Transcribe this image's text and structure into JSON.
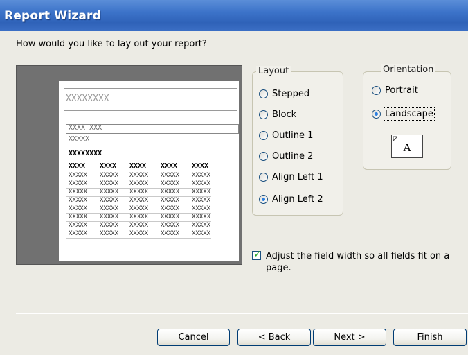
{
  "window": {
    "title": "Report Wizard"
  },
  "question": "How would you like to lay out your report?",
  "preview": {
    "header": "XXXXXXXX",
    "group1": "XXXX XXX",
    "group2": "XXXXX",
    "section": "XXXXXXXX",
    "col_headers": [
      "XXXX",
      "XXXX",
      "XXXX",
      "XXXX",
      "XXXX"
    ],
    "row_cell": "XXXXX",
    "row_count": 8
  },
  "layout": {
    "legend": "Layout",
    "options": [
      {
        "label": "Stepped",
        "accel": "S",
        "selected": false
      },
      {
        "label": "Block",
        "accel": "k",
        "selected": false
      },
      {
        "label": "Outline 1",
        "accel": "O",
        "selected": false
      },
      {
        "label": "Outline 2",
        "accel": "u",
        "selected": false
      },
      {
        "label": "Align Left 1",
        "accel": "A",
        "selected": false
      },
      {
        "label": "Align Left 2",
        "accel": "i",
        "selected": true
      }
    ]
  },
  "orientation": {
    "legend": "Orientation",
    "options": [
      {
        "label": "Portrait",
        "selected": false
      },
      {
        "label": "Landscape",
        "selected": true
      }
    ],
    "icon_letter": "A"
  },
  "adjust_width": {
    "label": "Adjust the field width so all fields fit on a page.",
    "checked": true
  },
  "buttons": {
    "cancel": "Cancel",
    "back": "< Back",
    "next": "Next >",
    "finish": "Finish"
  },
  "colors": {
    "title_bar": "#3c73c9",
    "dialog_bg": "#ecebe4",
    "selected_radio": "#2c8d1f"
  }
}
